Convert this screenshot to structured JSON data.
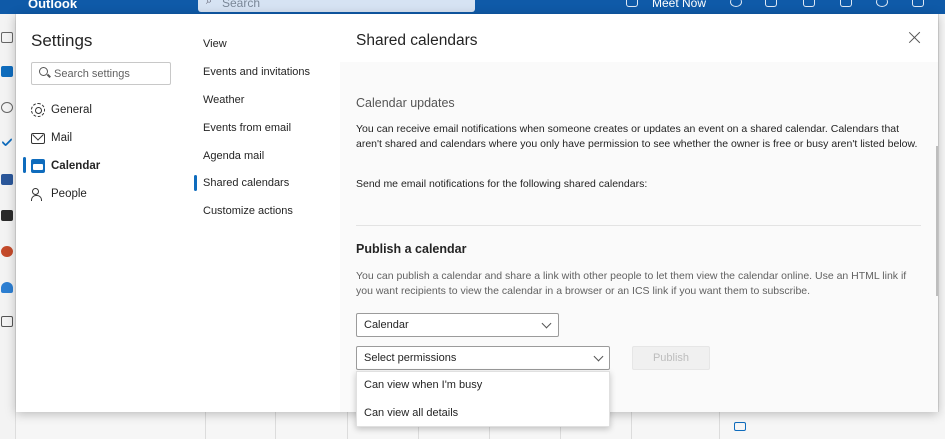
{
  "app": {
    "title": "Outlook"
  },
  "topbar": {
    "search_placeholder": "Search",
    "meet_now": "Meet Now"
  },
  "settings": {
    "title": "Settings",
    "search_placeholder": "Search settings",
    "categories": [
      {
        "label": "General",
        "icon": "gear-icon",
        "active": false
      },
      {
        "label": "Mail",
        "icon": "mail-icon",
        "active": false
      },
      {
        "label": "Calendar",
        "icon": "calendar-icon",
        "active": true
      },
      {
        "label": "People",
        "icon": "people-icon",
        "active": false
      }
    ],
    "subcategories": [
      {
        "label": "View",
        "active": false
      },
      {
        "label": "Events and invitations",
        "active": false
      },
      {
        "label": "Weather",
        "active": false
      },
      {
        "label": "Events from email",
        "active": false
      },
      {
        "label": "Agenda mail",
        "active": false
      },
      {
        "label": "Shared calendars",
        "active": true
      },
      {
        "label": "Customize actions",
        "active": false
      }
    ]
  },
  "content": {
    "title": "Shared calendars",
    "calendar_updates": {
      "heading": "Calendar updates",
      "description": "You can receive email notifications when someone creates or updates an event on a shared calendar. Calendars that aren't shared and calendars where you only have permission to see whether the owner is free or busy aren't listed below.",
      "prompt": "Send me email notifications for the following shared calendars:"
    },
    "publish": {
      "heading": "Publish a calendar",
      "description": "You can publish a calendar and share a link with other people to let them view the calendar online. Use an HTML link if you want recipients to view the calendar in a browser or an ICS link if you want them to subscribe.",
      "calendar_select": "Calendar",
      "permissions_select": "Select permissions",
      "publish_button": "Publish",
      "permission_options": [
        "Can view when I'm busy",
        "Can view all details"
      ]
    }
  },
  "colors": {
    "accent": "#0f6cbd",
    "header": "#0f5aa8"
  }
}
